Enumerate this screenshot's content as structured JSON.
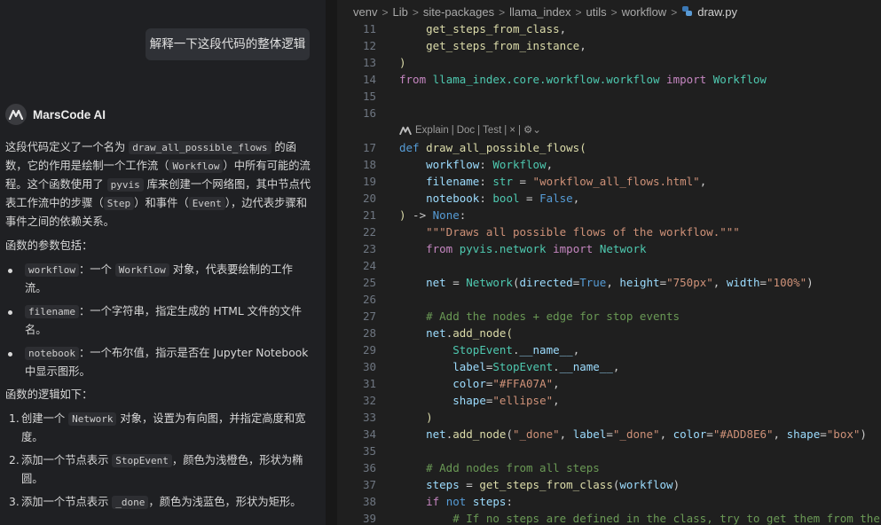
{
  "chat": {
    "user_message": "解释一下这段代码的整体逻辑",
    "assistant_name": "MarsCode AI",
    "intro": {
      "t1": "这段代码定义了一个名为 ",
      "c1": "draw_all_possible_flows",
      "t2": " 的函数，它的作用是绘制一个工作流（",
      "c2": "Workflow",
      "t3": "）中所有可能的流程。这个函数使用了 ",
      "c3": "pyvis",
      "t4": " 库来创建一个网络图，其中节点代表工作流中的步骤（",
      "c4": "Step",
      "t5": "）和事件（",
      "c5": "Event",
      "t6": "），边代表步骤和事件之间的依赖关系。"
    },
    "params_heading": "函数的参数包括：",
    "params": [
      {
        "code": "workflow",
        "t1": "：一个 ",
        "code2": "Workflow",
        "t2": " 对象，代表要绘制的工作流。"
      },
      {
        "code": "filename",
        "t1": "：一个字符串，指定生成的 HTML 文件的文件名。"
      },
      {
        "code": "notebook",
        "t1": "：一个布尔值，指示是否在 Jupyter Notebook 中显示图形。"
      }
    ],
    "logic_heading": "函数的逻辑如下：",
    "steps": [
      {
        "num": "1.",
        "t1": "创建一个 ",
        "code": "Network",
        "t2": " 对象，设置为有向图，并指定高度和宽度。"
      },
      {
        "num": "2.",
        "t1": "添加一个节点表示 ",
        "code": "StopEvent",
        "t2": "，颜色为浅橙色，形状为椭圆。"
      },
      {
        "num": "3.",
        "t1": "添加一个节点表示 ",
        "code": "_done",
        "t2": "，颜色为浅蓝色，形状为矩形。"
      }
    ]
  },
  "editor": {
    "breadcrumb": [
      "venv",
      "Lib",
      "site-packages",
      "llama_index",
      "utils",
      "workflow",
      "draw.py"
    ],
    "code_lens": [
      "Explain",
      "|",
      "Doc",
      "|",
      "Test",
      "|",
      "×",
      "|"
    ],
    "line_numbers": [
      "11",
      "12",
      "13",
      "14",
      "15",
      "16",
      "17",
      "18",
      "19",
      "20",
      "21",
      "22",
      "23",
      "24",
      "25",
      "26",
      "27",
      "28",
      "29",
      "30",
      "31",
      "32",
      "33",
      "34",
      "35",
      "36",
      "37",
      "38",
      "39"
    ]
  },
  "colors": {
    "keyword": "#569cd6",
    "control": "#c586c0",
    "function": "#dcdcaa",
    "class": "#4ec9b0",
    "string": "#ce9178",
    "variable": "#9cdcfe",
    "comment": "#6a9955",
    "stop_event_color": "#FFA07A",
    "done_color": "#ADD8E6"
  }
}
